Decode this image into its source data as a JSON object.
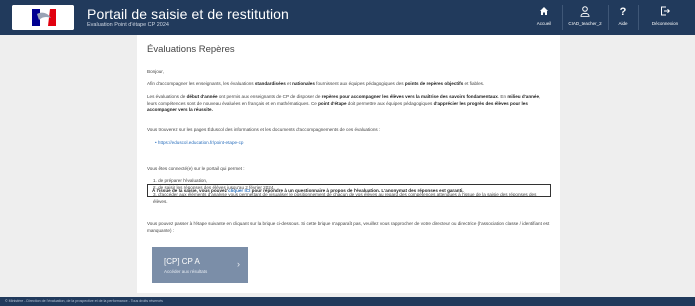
{
  "header": {
    "title": "Portail de saisie et de restitution",
    "subtitle": "Evaluation Point d'étape CP 2024",
    "buttons": [
      {
        "label": "Accueil",
        "icon": "home-icon"
      },
      {
        "label": "CIAD_teacher_2",
        "icon": "user-icon"
      },
      {
        "label": "Aide",
        "icon": "help-icon"
      },
      {
        "label": "Déconnexion",
        "icon": "logout-icon"
      }
    ]
  },
  "main": {
    "title": "Évaluations Repères",
    "greeting": "Bonjour,",
    "p1": {
      "a": "Afin d'accompagner les enseignants, les évaluations ",
      "b": "standardisées",
      "c": " et ",
      "d": "nationales",
      "e": " fournissent aux équipes pédagogiques des ",
      "f": "points de repères objectifs",
      "g": " et fiables."
    },
    "p2": {
      "a": "Les évaluations de ",
      "b": "début d'année",
      "c": " ont permis aux enseignants de CP de disposer de ",
      "d": "repères pour accompagner les élèves vers la maîtrise des savoirs fondamentaux",
      "e": ". En ",
      "f": "milieu d'année",
      "g": ", leurs compétences sont de nouveau évaluées en français et en mathématiques. Ce ",
      "h": "point d'étape",
      "i": " doit permettre aux équipes pédagogiques ",
      "j": "d'apprécier les progrès des élèves pour les accompagner vers la réussite."
    },
    "p3": "Vous trouverez sur les pages Éduscol des informations et les documents d'accompagnements de ces évaluations :",
    "link": "https://eduscol.education.fr/point-etape-cp",
    "notice": {
      "a": "À l'issue de la saisie, vous pouvez ",
      "link": "cliquer ICI",
      "b": " pour répondre à un questionnaire à propos de l'évaluation. L'anonymat des réponses est garanti."
    },
    "list_intro": "Vous êtes connecté(e) sur le portail qui permet :",
    "list": [
      "1. de préparer l'évaluation,",
      "2. de saisir les réponses des élèves jusqu'au 2 février 2024,",
      "3. d'accéder aux éléments d'analyse vous permettant de visualiser le positionnement de chacun de vos élèves au regard des compétences attendues à l'issue de la saisie des réponses des élèves."
    ],
    "p4": "Vous pouvez passer à l'étape suivante en cliquant sur la brique ci-dessous. Si cette brique n'apparaît pas, veuillez vous rapprocher de votre directeur ou directrice (l'association classe / identifiant est manquante) :",
    "tile": {
      "title": "[CP] CP A",
      "subtitle": "Accéder aux résultats"
    }
  },
  "footer": {
    "text": "© Ministère - Direction de l'évaluation, de la prospective et de la performance - Tous droits réservés"
  },
  "colors": {
    "header_bg": "#213a5c",
    "tile_bg": "#7b8ea8",
    "link": "#2a6fbd"
  }
}
